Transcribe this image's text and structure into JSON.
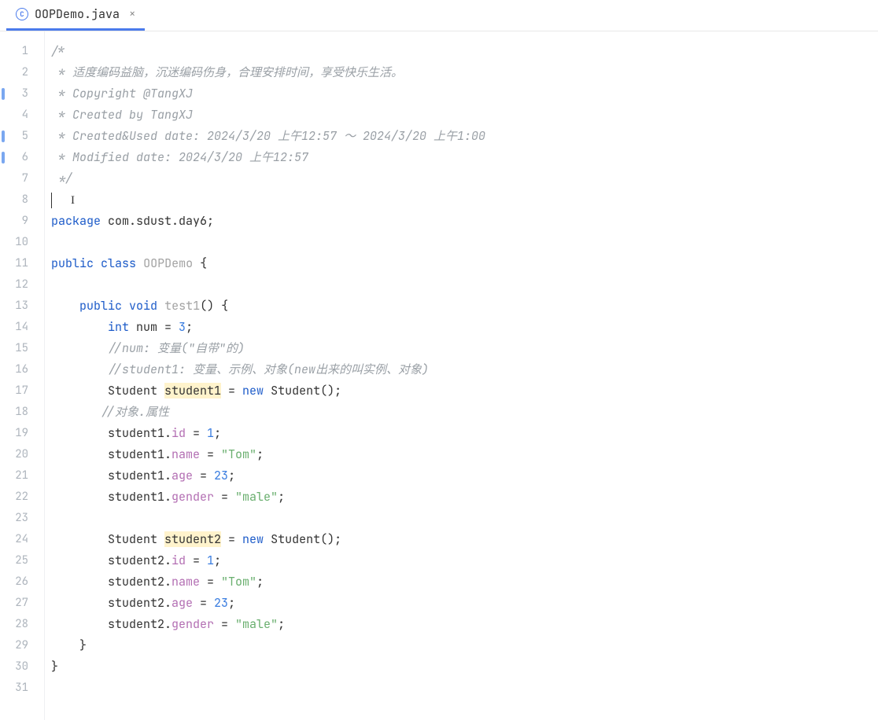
{
  "tab": {
    "icon_letter": "C",
    "filename": "OOPDemo.java",
    "close_glyph": "×"
  },
  "gutter": {
    "lines": [
      "1",
      "2",
      "3",
      "4",
      "5",
      "6",
      "7",
      "8",
      "9",
      "10",
      "11",
      "12",
      "13",
      "14",
      "15",
      "16",
      "17",
      "18",
      "19",
      "20",
      "21",
      "22",
      "23",
      "24",
      "25",
      "26",
      "27",
      "28",
      "29",
      "30",
      "31"
    ],
    "diff_lines": [
      3,
      5,
      6
    ]
  },
  "code": {
    "c1": "/*",
    "c2": " * 适度编码益脑，沉迷编码伤身，合理安排时间，享受快乐生活。",
    "c3": " * Copyright @TangXJ",
    "c4": " * Created by TangXJ",
    "c5": " * Created&Used date: 2024/3/20 上午12:57 ～ 2024/3/20 上午1:00",
    "c6": " * Modified date: 2024/3/20 上午12:57",
    "c7": " */",
    "l8_cursor_glyph": "I",
    "l9": {
      "kw_package": "package",
      "pkg": " com.sdust.day6;"
    },
    "l11": {
      "kw_public": "public",
      "kw_class": "class",
      "name": "OOPDemo",
      "tail": " {"
    },
    "l13": {
      "kw_public": "public",
      "kw_void": "void",
      "name": "test1",
      "tail": "() {"
    },
    "l14": {
      "kw_int": "int",
      "rest": " num = ",
      "num": "3",
      "semi": ";"
    },
    "l15": "//num: 变量(\"自带\"的)",
    "l16": "//student1: 变量、示例、对象(new出来的叫实例、对象)",
    "l17": {
      "type": "Student ",
      "var": "student1",
      "eq": " = ",
      "kw_new": "new",
      "ctor": " Student();"
    },
    "l18": "//对象.属性",
    "l19": {
      "obj": "student1.",
      "field": "id",
      "rest": " = ",
      "val": "1",
      "semi": ";"
    },
    "l20": {
      "obj": "student1.",
      "field": "name",
      "rest": " = ",
      "val": "\"Tom\"",
      "semi": ";"
    },
    "l21": {
      "obj": "student1.",
      "field": "age",
      "rest": " = ",
      "val": "23",
      "semi": ";"
    },
    "l22": {
      "obj": "student1.",
      "field": "gender",
      "rest": " = ",
      "val": "\"male\"",
      "semi": ";"
    },
    "l24": {
      "type": "Student ",
      "var": "student2",
      "eq": " = ",
      "kw_new": "new",
      "ctor": " Student();"
    },
    "l25": {
      "obj": "student2.",
      "field": "id",
      "rest": " = ",
      "val": "1",
      "semi": ";"
    },
    "l26": {
      "obj": "student2.",
      "field": "name",
      "rest": " = ",
      "val": "\"Tom\"",
      "semi": ";"
    },
    "l27": {
      "obj": "student2.",
      "field": "age",
      "rest": " = ",
      "val": "23",
      "semi": ";"
    },
    "l28": {
      "obj": "student2.",
      "field": "gender",
      "rest": " = ",
      "val": "\"male\"",
      "semi": ";"
    },
    "l29": "    }",
    "l30": "}"
  }
}
